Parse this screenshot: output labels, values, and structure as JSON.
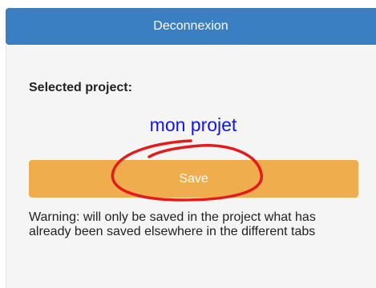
{
  "header": {
    "logout_label": "Deconnexion"
  },
  "project": {
    "selected_label": "Selected project:",
    "name": "mon projet"
  },
  "actions": {
    "save_label": "Save"
  },
  "warning": {
    "text": "Warning: will only be saved in the project what has already been saved elsewhere in the different tabs"
  },
  "colors": {
    "header_bg": "#3a7fc2",
    "save_bg": "#f0ad4e",
    "project_name": "#1414ee",
    "annotation": "#e31b1b"
  }
}
